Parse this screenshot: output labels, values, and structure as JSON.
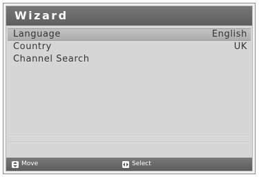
{
  "window": {
    "title": "Wizard"
  },
  "menu": {
    "items": [
      {
        "label": "Language",
        "value": "English",
        "selected": true
      },
      {
        "label": "Country",
        "value": "UK",
        "selected": false
      },
      {
        "label": "Channel Search",
        "value": "",
        "selected": false
      }
    ]
  },
  "footer": {
    "move_label": "Move",
    "move_icon": "up-down-arrows-icon",
    "select_label": "Select",
    "select_icon": "left-right-arrows-icon"
  },
  "colors": {
    "title_bar": "#666666",
    "panel_background": "#d6d6d6",
    "selected_row": "#b8b8b8",
    "text": "#333333"
  }
}
